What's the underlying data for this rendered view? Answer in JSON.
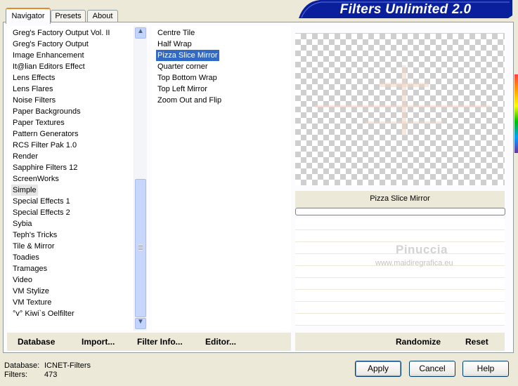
{
  "app": {
    "title": "Filters Unlimited 2.0"
  },
  "tabs": [
    {
      "label": "Navigator",
      "active": true
    },
    {
      "label": "Presets",
      "active": false
    },
    {
      "label": "About",
      "active": false
    }
  ],
  "categories": {
    "items": [
      "Greg's Factory Output Vol. II",
      "Greg's Factory Output",
      "Image Enhancement",
      "It@lian Editors Effect",
      "Lens Effects",
      "Lens Flares",
      "Noise Filters",
      "Paper Backgrounds",
      "Paper Textures",
      "Pattern Generators",
      "RCS Filter Pak 1.0",
      "Render",
      "Sapphire Filters 12",
      "ScreenWorks",
      "Simple",
      "Special Effects 1",
      "Special Effects 2",
      "Sybia",
      "Teph's Tricks",
      "Tile & Mirror",
      "Toadies",
      "Tramages",
      "Video",
      "VM Stylize",
      "VM Texture",
      "°v° Kiwi`s Oelfilter"
    ],
    "selected": "Simple"
  },
  "filters": {
    "items": [
      "Centre Tile",
      "Half Wrap",
      "Pizza Slice Mirror",
      "Quarter corner",
      "Top Bottom Wrap",
      "Top Left Mirror",
      "Zoom Out and Flip"
    ],
    "selected": "Pizza Slice Mirror"
  },
  "preview": {
    "filter_name": "Pizza Slice Mirror",
    "watermark_name": "Pinuccia",
    "watermark_url": "www.maidiregrafica.eu"
  },
  "toolbar": {
    "database": "Database",
    "import": "Import...",
    "filter_info": "Filter Info...",
    "editor": "Editor...",
    "randomize": "Randomize",
    "reset": "Reset"
  },
  "status": {
    "database_label": "Database:",
    "database_value": "ICNET-Filters",
    "filters_label": "Filters:",
    "filters_value": "473"
  },
  "buttons": {
    "apply": "Apply",
    "cancel": "Cancel",
    "help": "Help"
  },
  "colors": {
    "banner": "#0a1f9c",
    "selection": "#316ac5",
    "tab_accent": "#e68b2c",
    "dialog_bg": "#ece9d8"
  }
}
